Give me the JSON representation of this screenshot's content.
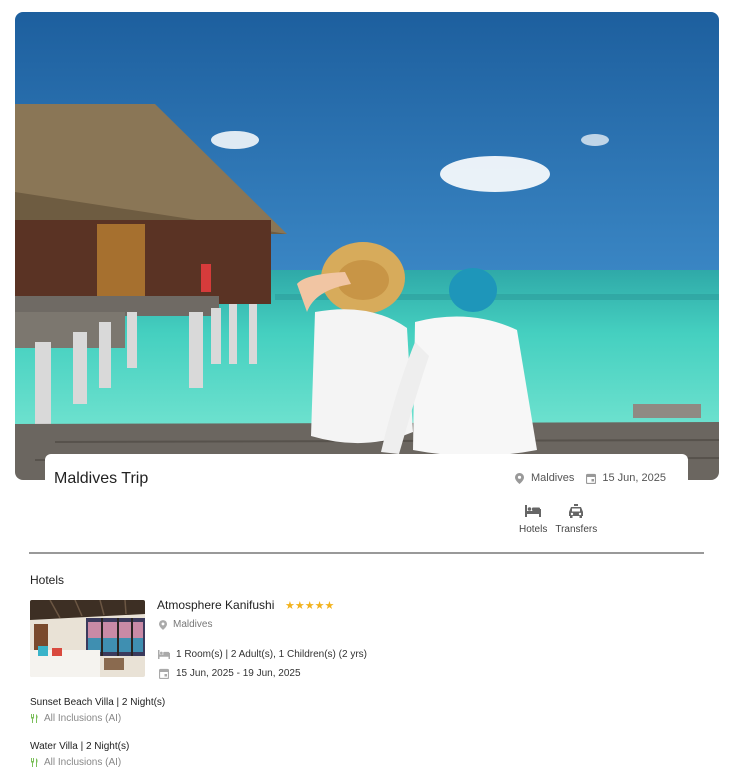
{
  "trip": {
    "title": "Maldives Trip",
    "location": "Maldives",
    "date": "15 Jun, 2025"
  },
  "services": [
    {
      "label": "Hotels",
      "icon": "bed-icon"
    },
    {
      "label": "Transfers",
      "icon": "taxi-icon"
    }
  ],
  "hotels_section": {
    "title": "Hotels",
    "hotel": {
      "name": "Atmosphere Kanifushi",
      "stars": "★★★★★",
      "rating": 5,
      "location": "Maldives",
      "rooms_guests": "1 Room(s) | 2 Adult(s), 1 Children(s) (2 yrs)",
      "dates": "15 Jun, 2025 - 19 Jun, 2025"
    },
    "rooms": [
      {
        "name": "Sunset Beach Villa | 2 Night(s)",
        "inclusion": "All Inclusions (AI)"
      },
      {
        "name": "Water Villa | 2 Night(s)",
        "inclusion": "All Inclusions (AI)"
      }
    ]
  },
  "colors": {
    "star": "#f2b21c",
    "inclusion_icon": "#7bbf5a",
    "divider": "#999999"
  }
}
